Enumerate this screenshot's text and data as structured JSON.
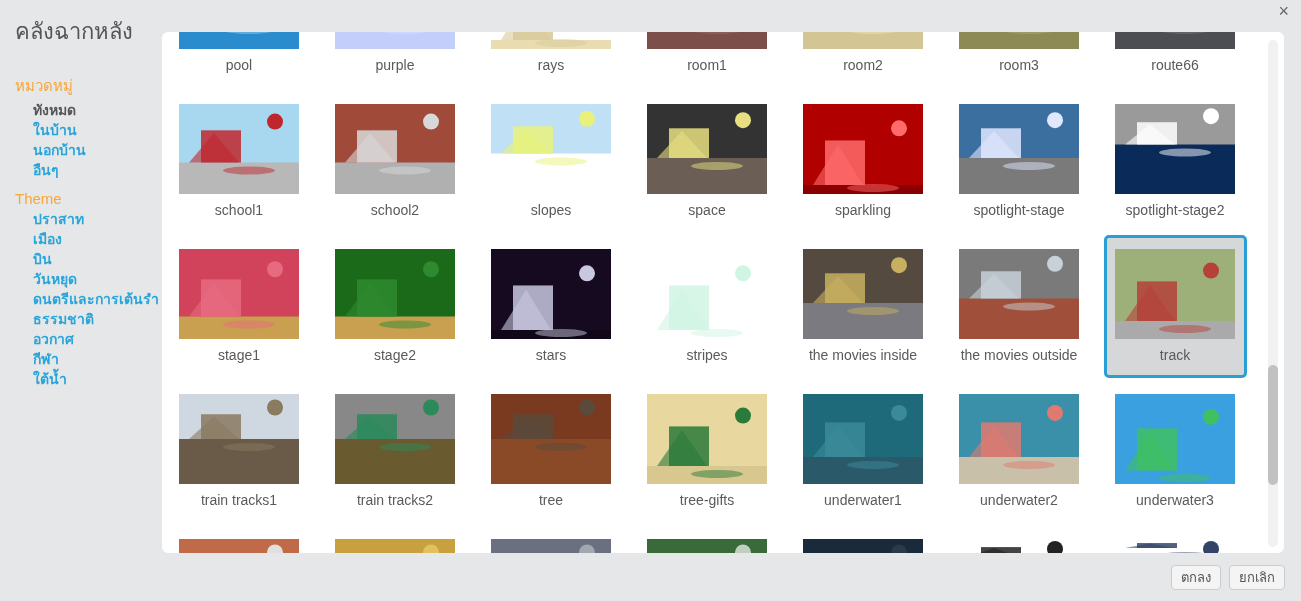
{
  "dialog": {
    "title": "คลังฉากหลัง",
    "close": "×"
  },
  "sidebar": {
    "groups": [
      {
        "heading": "หมวดหมู่",
        "items": [
          {
            "label": "ทังหมด",
            "selected": true
          },
          {
            "label": "ในบ้าน",
            "selected": false
          },
          {
            "label": "นอกบ้าน",
            "selected": false
          },
          {
            "label": "อืนๆ",
            "selected": false
          }
        ]
      },
      {
        "heading": "Theme",
        "items": [
          {
            "label": "ปราสาท",
            "selected": false
          },
          {
            "label": "เมือง",
            "selected": false
          },
          {
            "label": "บิน",
            "selected": false
          },
          {
            "label": "วันหยุด",
            "selected": false
          },
          {
            "label": "ดนตรีและการเต้นรำ",
            "selected": false
          },
          {
            "label": "ธรรมชาติ",
            "selected": false
          },
          {
            "label": "อวกาศ",
            "selected": false
          },
          {
            "label": "กีฬา",
            "selected": false
          },
          {
            "label": "ใต้น้ำ",
            "selected": false
          }
        ]
      }
    ]
  },
  "tiles": [
    {
      "label": "pool",
      "selected": false
    },
    {
      "label": "purple",
      "selected": false
    },
    {
      "label": "rays",
      "selected": false
    },
    {
      "label": "room1",
      "selected": false
    },
    {
      "label": "room2",
      "selected": false
    },
    {
      "label": "room3",
      "selected": false
    },
    {
      "label": "route66",
      "selected": false
    },
    {
      "label": "school1",
      "selected": false
    },
    {
      "label": "school2",
      "selected": false
    },
    {
      "label": "slopes",
      "selected": false
    },
    {
      "label": "space",
      "selected": false
    },
    {
      "label": "sparkling",
      "selected": false
    },
    {
      "label": "spotlight-stage",
      "selected": false
    },
    {
      "label": "spotlight-stage2",
      "selected": false
    },
    {
      "label": "stage1",
      "selected": false
    },
    {
      "label": "stage2",
      "selected": false
    },
    {
      "label": "stars",
      "selected": false
    },
    {
      "label": "stripes",
      "selected": false
    },
    {
      "label": "the movies inside",
      "selected": false
    },
    {
      "label": "the movies outside",
      "selected": false
    },
    {
      "label": "track",
      "selected": true
    },
    {
      "label": "train tracks1",
      "selected": false
    },
    {
      "label": "train tracks2",
      "selected": false
    },
    {
      "label": "tree",
      "selected": false
    },
    {
      "label": "tree-gifts",
      "selected": false
    },
    {
      "label": "underwater1",
      "selected": false
    },
    {
      "label": "underwater2",
      "selected": false
    },
    {
      "label": "underwater3",
      "selected": false
    },
    {
      "selected": false
    },
    {
      "selected": false
    },
    {
      "selected": false
    },
    {
      "selected": false
    },
    {
      "selected": false
    },
    {
      "selected": false
    },
    {
      "selected": false
    }
  ],
  "buttons": [
    "ตกลง",
    "ยกเลิก"
  ]
}
